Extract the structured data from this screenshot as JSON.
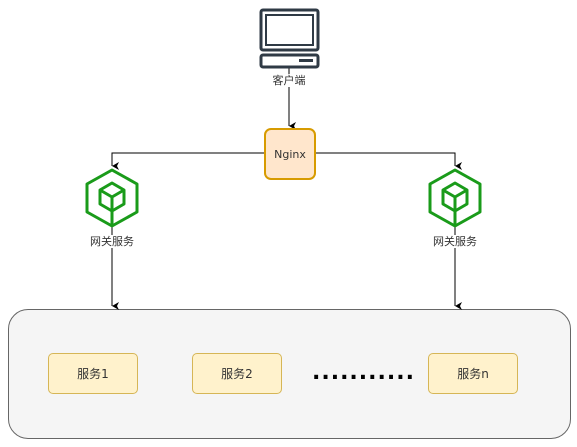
{
  "client": {
    "label": "客户端",
    "icon": "computer-icon"
  },
  "nginx": {
    "label": "Nginx"
  },
  "gateways": [
    {
      "label": "网关服务"
    },
    {
      "label": "网关服务"
    }
  ],
  "services": [
    {
      "label": "服务1"
    },
    {
      "label": "服务2"
    },
    {
      "label": "服务n"
    }
  ],
  "ellipsis": "...........",
  "colors": {
    "nginx_fill": "#ffe6cc",
    "nginx_stroke": "#d79b00",
    "gateway": "#1a9b1a",
    "service_fill": "#fff2cc",
    "service_stroke": "#d6b656",
    "container_fill": "#f5f5f5"
  }
}
